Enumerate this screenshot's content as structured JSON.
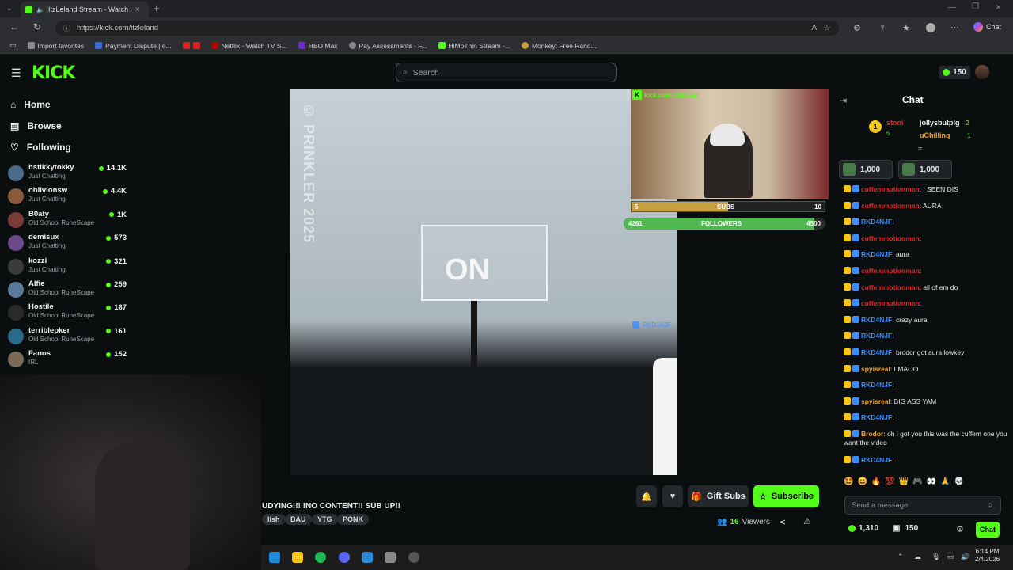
{
  "browser": {
    "tab_title": "ItzLeland Stream - Watch Li...",
    "url": "https://kick.com/itzleland",
    "bookmarks": [
      "Import favorites",
      "Payment Dispute | e...",
      "Netflix - Watch TV S...",
      "HBO Max",
      "Pay Assessments - F...",
      "HiMoThin Stream -...",
      "Monkey: Free Rand..."
    ],
    "copilot_label": "Chat"
  },
  "kick": {
    "logo": "KICK",
    "search_placeholder": "Search",
    "points": "150",
    "nav": [
      "Home",
      "Browse",
      "Following"
    ],
    "following": [
      {
        "name": "hstikkytokky",
        "category": "Just Chatting",
        "viewers": "14.1K",
        "color": "#4a6b8a"
      },
      {
        "name": "oblivionsw",
        "category": "Just Chatting",
        "viewers": "4.4K",
        "color": "#8a5a3a"
      },
      {
        "name": "B0aty",
        "category": "Old School RuneScape",
        "viewers": "1K",
        "color": "#7a3a3a"
      },
      {
        "name": "demisux",
        "category": "Just Chatting",
        "viewers": "573",
        "color": "#6a4a8a"
      },
      {
        "name": "kozzi",
        "category": "Just Chatting",
        "viewers": "321",
        "color": "#3a3a3a"
      },
      {
        "name": "Alfie",
        "category": "Old School RuneScape",
        "viewers": "259",
        "color": "#5a7a9a"
      },
      {
        "name": "Hostile",
        "category": "Old School RuneScape",
        "viewers": "187",
        "color": "#2a2a2a"
      },
      {
        "name": "terriblepker",
        "category": "Old School RuneScape",
        "viewers": "161",
        "color": "#2a6a8a"
      },
      {
        "name": "Fanos",
        "category": "IRL",
        "viewers": "152",
        "color": "#7a6a5a"
      }
    ]
  },
  "video": {
    "watermark": "© PRINKLER 2025",
    "overlay_text": "ON",
    "overlay_url": "kick.com/itzleland",
    "chat_popup": "RKD4NJF",
    "subs_label": "SUBS",
    "subs_current": "5",
    "subs_goal": "10",
    "subs_progress": 0.5,
    "followers_label": "FOLLOWERS",
    "followers_current": "4261",
    "followers_goal": "4500",
    "followers_progress": 0.947
  },
  "stream": {
    "title": "UDYING!!! !NO CONTENT!! SUB UP!!",
    "tags": [
      "lish",
      "BAU",
      "YTG",
      "PONK"
    ],
    "viewers": "16",
    "viewers_label": "Viewers",
    "gift_label": "Gift Subs",
    "subscribe_label": "Subscribe"
  },
  "chat": {
    "title": "Chat",
    "leaderboard": [
      {
        "name": "stooi",
        "count": "5"
      },
      {
        "name": "jollysbutplg",
        "count": "2"
      },
      {
        "name": "uChilling",
        "count": "1"
      }
    ],
    "pinned": [
      "1,000",
      "1,000"
    ],
    "messages": [
      {
        "user": "cuffemmotionman",
        "text": "I SEEN DIS",
        "color": "#e0232a"
      },
      {
        "user": "cuffemmotionman",
        "text": "AURA",
        "color": "#e0232a"
      },
      {
        "user": "RKD4NJF",
        "text": "",
        "color": "#3a8cff"
      },
      {
        "user": "cuffemmotionman",
        "text": "",
        "color": "#e0232a"
      },
      {
        "user": "RKD4NJF",
        "text": "aura",
        "color": "#3a8cff"
      },
      {
        "user": "cuffemmotionman",
        "text": "",
        "color": "#e0232a"
      },
      {
        "user": "cuffemmotionman",
        "text": "all of em do",
        "color": "#e0232a"
      },
      {
        "user": "cuffemmotionman",
        "text": "",
        "color": "#e0232a"
      },
      {
        "user": "RKD4NJF",
        "text": "crazy aura",
        "color": "#3a8cff"
      },
      {
        "user": "RKD4NJF",
        "text": "",
        "color": "#3a8cff"
      },
      {
        "user": "RKD4NJF",
        "text": "brodor got aura lowkey",
        "color": "#3a8cff"
      },
      {
        "user": "spyisreal",
        "text": "LMAOO",
        "color": "#f5a623"
      },
      {
        "user": "RKD4NJF",
        "text": "",
        "color": "#3a8cff"
      },
      {
        "user": "spyisreal",
        "text": "BIG ASS YAM",
        "color": "#f5a623"
      },
      {
        "user": "RKD4NJF",
        "text": "",
        "color": "#3a8cff"
      },
      {
        "user": "Brodor",
        "text": "oh i got you this was the cuffem one you want the video",
        "color": "#f5a623"
      },
      {
        "user": "RKD4NJF",
        "text": "",
        "color": "#3a8cff"
      }
    ],
    "input_placeholder": "Send a message",
    "balance": "1,310",
    "points": "150",
    "send_label": "Chat"
  },
  "system": {
    "time": "6:14 PM",
    "date": "2/4/2026"
  }
}
